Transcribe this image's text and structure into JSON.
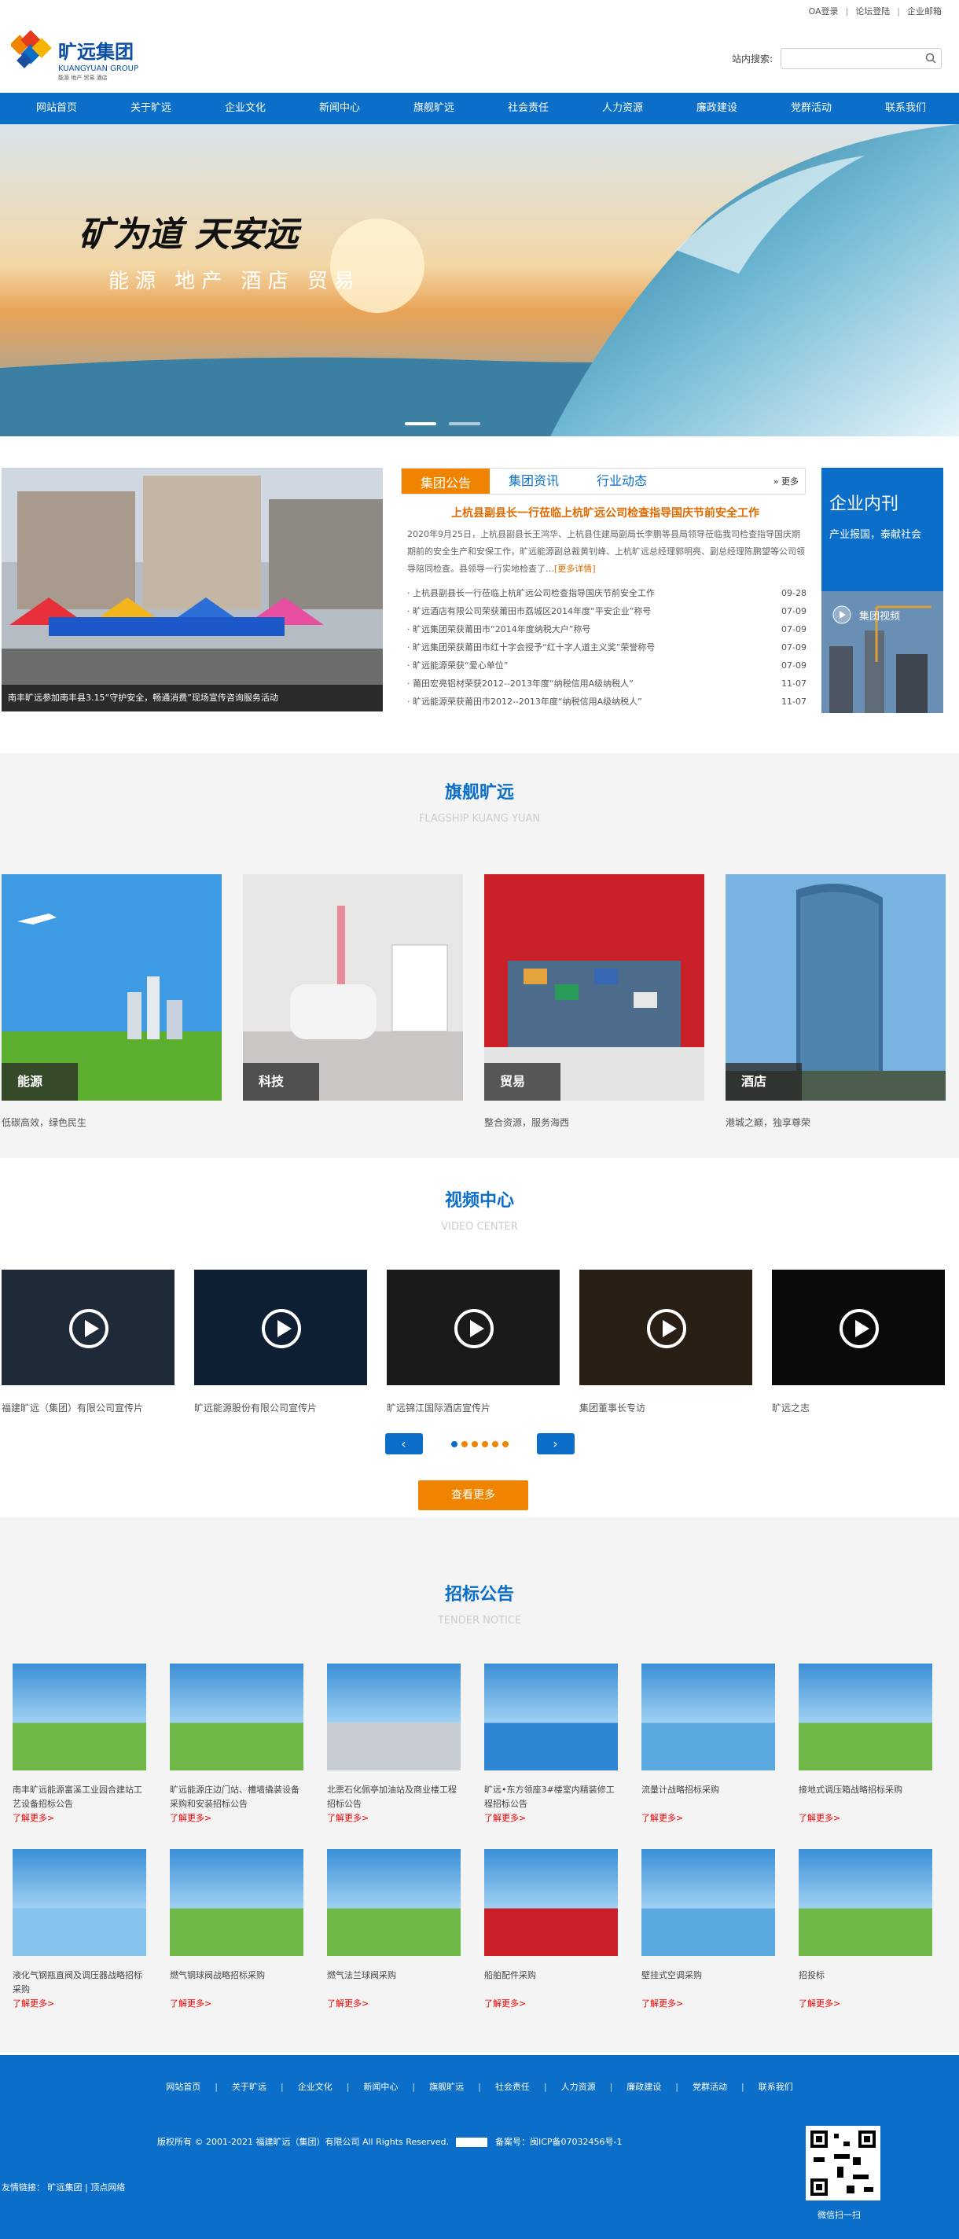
{
  "topbar": {
    "links": [
      "OA登录",
      "论坛登陆",
      "企业邮箱"
    ]
  },
  "logo": {
    "cn": "旷远集团",
    "en": "KUANGYUAN GROUP",
    "tags": "能源 地产 贸易 酒店"
  },
  "search": {
    "label": "站内搜索:",
    "placeholder": ""
  },
  "nav": [
    "网站首页",
    "关于旷远",
    "企业文化",
    "新闻中心",
    "旗舰旷远",
    "社会责任",
    "人力资源",
    "廉政建设",
    "党群活动",
    "联系我们"
  ],
  "banner": {
    "calligraphy": "矿为道 天安远",
    "tagline": "能源 地产 酒店 贸易"
  },
  "news": {
    "photo_caption": "南丰旷远参加南丰县3.15“守护安全，畅通消费”现场宣传咨询服务活动",
    "tabs": [
      "集团公告",
      "集团资讯",
      "行业动态"
    ],
    "more": "更多",
    "headline": "上杭县副县长一行莅临上杭旷远公司检查指导国庆节前安全工作",
    "summary": "2020年9月25日，上杭县副县长王鸿华、上杭县住建局副局长李鹏等县局领导莅临我司检查指导国庆期期前的安全生产和安保工作，旷远能源副总裁黄钊峰、上杭旷远总经理郭明亮、副总经理陈鹏望等公司领导陪同检查。县领导一行实地检查了…",
    "summary_more": "[更多详情]",
    "items": [
      {
        "t": "上杭县副县长一行莅临上杭旷远公司检查指导国庆节前安全工作",
        "d": "09-28"
      },
      {
        "t": "旷远酒店有限公司荣获莆田市荔城区2014年度“平安企业”称号",
        "d": "07-09"
      },
      {
        "t": "旷远集团荣获莆田市“2014年度纳税大户”称号",
        "d": "07-09"
      },
      {
        "t": "旷远集团荣获莆田市红十字会授予“红十字人道主义奖”荣誉称号",
        "d": "07-09"
      },
      {
        "t": "旷远能源荣获“爱心单位”",
        "d": "07-09"
      },
      {
        "t": "莆田宏亮铝材荣获2012--2013年度“纳税信用A级纳税人”",
        "d": "11-07"
      },
      {
        "t": "旷远能源荣获莆田市2012--2013年度“纳税信用A级纳税人”",
        "d": "11-07"
      }
    ]
  },
  "magazine": {
    "title": "企业内刊",
    "subtitle": "产业报国，泰献社会",
    "video": "集团视频"
  },
  "flagship": {
    "title": "旗舰旷远",
    "sub": "FLAGSHIP KUANG YUAN",
    "items": [
      {
        "label": "能源",
        "desc": "低碳高效，绿色民生"
      },
      {
        "label": "科技",
        "desc": ""
      },
      {
        "label": "贸易",
        "desc": "整合资源，服务海西"
      },
      {
        "label": "酒店",
        "desc": "港城之巅，独享尊荣"
      }
    ]
  },
  "video": {
    "title": "视频中心",
    "sub": "VIDEO CENTER",
    "items": [
      "福建旷远（集团）有限公司宣传片",
      "旷远能源股份有限公司宣传片",
      "旷远锦江国际酒店宣传片",
      "集团董事长专访",
      "旷远之志"
    ],
    "more": "查看更多"
  },
  "tender": {
    "title": "招标公告",
    "sub": "TENDER NOTICE",
    "more": "了解更多>",
    "items": [
      "南丰旷远能源富溪工业园合建站工艺设备招标公告",
      "旷远能源庄边门站、槽墙撬装设备采购和安装招标公告",
      "北票石化佩亭加油站及商业楼工程招标公告",
      "旷远•东方领座3#楼室内精装修工程招标公告",
      "流量计战略招标采购",
      "接地式调压箱战略招标采购",
      "液化气钢瓶直阀及调压器战略招标采购",
      "燃气钢球阀战略招标采购",
      "燃气法兰球阀采购",
      "船舶配件采购",
      "壁挂式空调采购",
      "招投标"
    ]
  },
  "footer": {
    "nav": [
      "网站首页",
      "关于旷远",
      "企业文化",
      "新闻中心",
      "旗舰旷远",
      "社会责任",
      "人力资源",
      "廉政建设",
      "党群活动",
      "联系我们"
    ],
    "copyright": "版权所有 © 2001-2021 福建旷远（集团）有限公司 All Rights Reserved.",
    "icp": "备案号：闽ICP备07032456号-1",
    "links_label": "友情链接：",
    "links": [
      "旷远集团",
      "顶点网络"
    ],
    "wechat": "微信扫一扫"
  }
}
